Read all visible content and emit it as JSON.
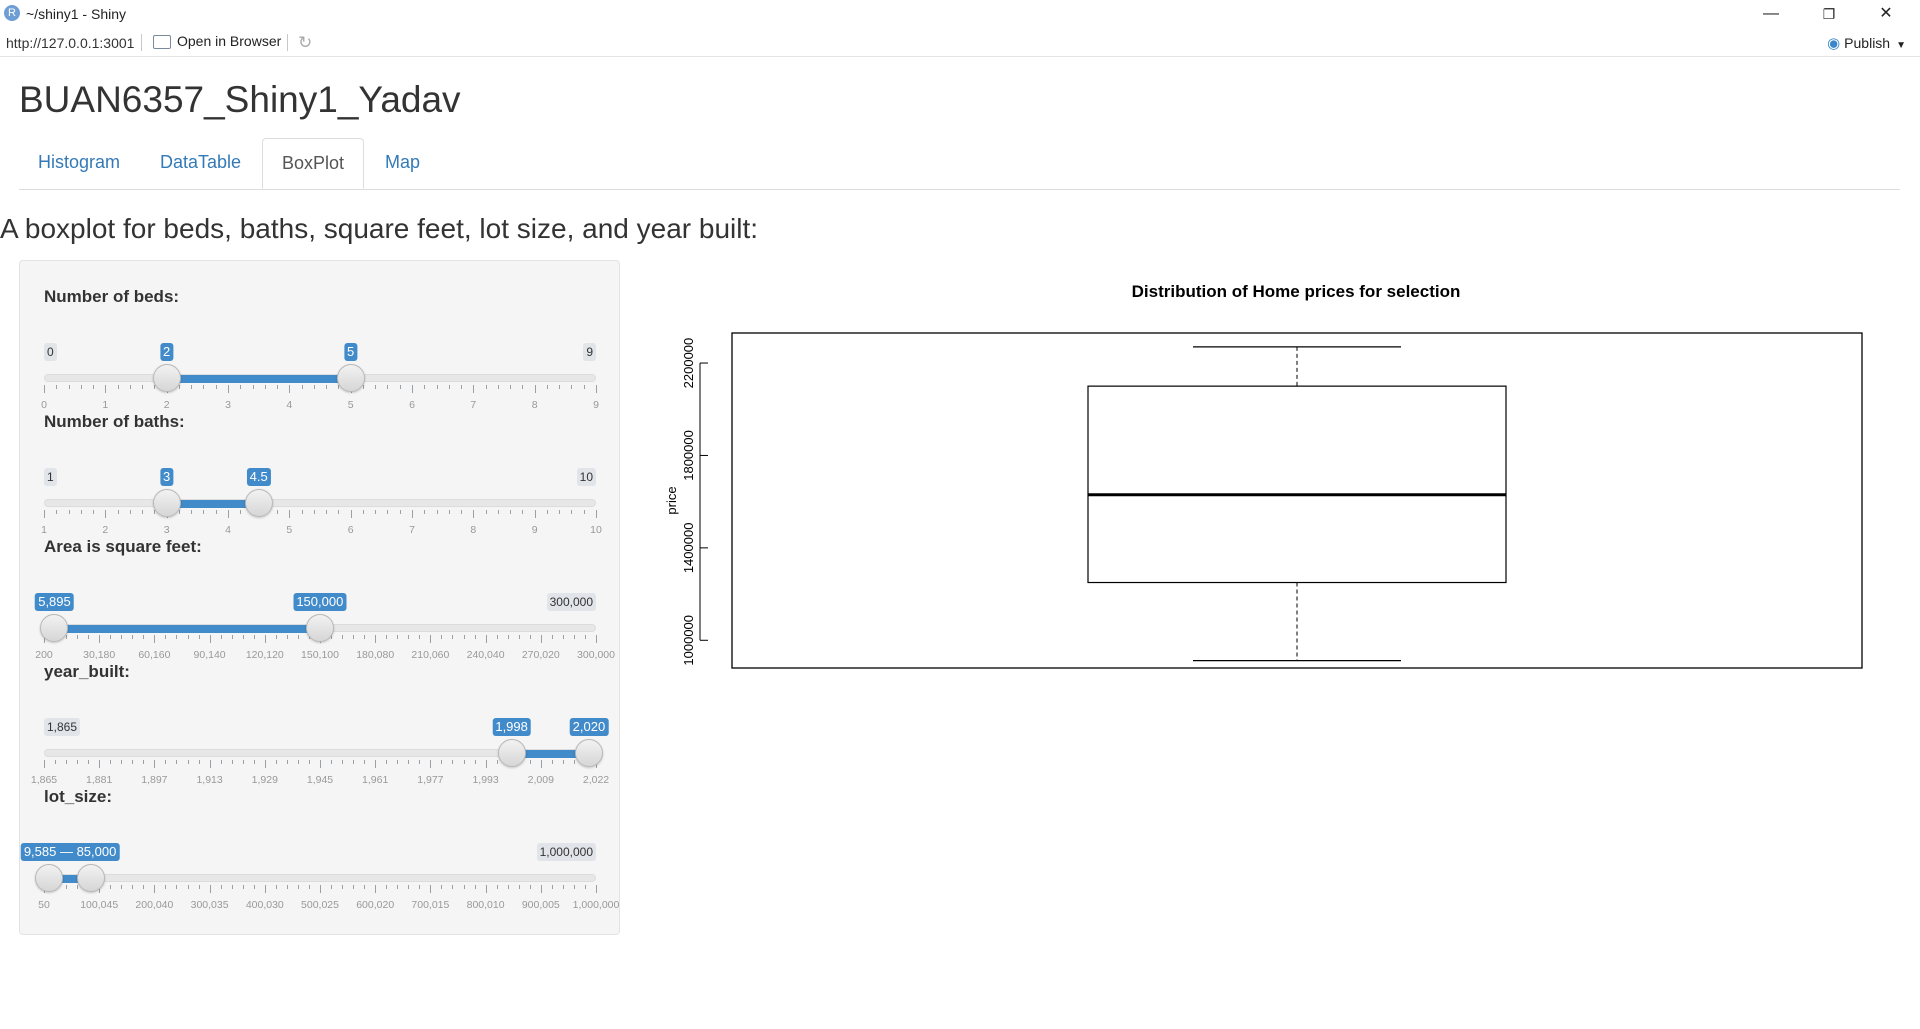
{
  "window": {
    "title": "~/shiny1 - Shiny",
    "minimize": "—",
    "restore": "❐",
    "close": "✕"
  },
  "toolbar": {
    "url": "http://127.0.0.1:3001",
    "open_in_browser": "Open in Browser",
    "refresh_icon": "↻",
    "publish": "Publish"
  },
  "app": {
    "title": "BUAN6357_Shiny1_Yadav",
    "tabs": [
      "Histogram",
      "DataTable",
      "BoxPlot",
      "Map"
    ],
    "active_tab": "BoxPlot",
    "heading": "A boxplot for beds, baths, square feet, lot size, and year built:"
  },
  "sliders": [
    {
      "label": "Number of beds:",
      "min": "0",
      "max": "9",
      "from": "2",
      "to": "5",
      "from_value": 2,
      "to_value": 5,
      "range": [
        0,
        9
      ],
      "ticks": [
        "0",
        "1",
        "2",
        "3",
        "4",
        "5",
        "6",
        "7",
        "8",
        "9"
      ]
    },
    {
      "label": "Number of baths:",
      "min": "1",
      "max": "10",
      "from": "3",
      "to": "4.5",
      "from_value": 3,
      "to_value": 4.5,
      "range": [
        1,
        10
      ],
      "ticks": [
        "1",
        "2",
        "3",
        "4",
        "5",
        "6",
        "7",
        "8",
        "9",
        "10"
      ]
    },
    {
      "label": "Area is square feet:",
      "min": "200",
      "max": "300,000",
      "from": "5,895",
      "to": "150,000",
      "from_value": 5895,
      "to_value": 150000,
      "range": [
        200,
        300000
      ],
      "ticks": [
        "200",
        "30,180",
        "60,160",
        "90,140",
        "120,120",
        "150,100",
        "180,080",
        "210,060",
        "240,040",
        "270,020",
        "300,000"
      ]
    },
    {
      "label": "year_built:",
      "min": "1,865",
      "max": "2,022",
      "from": "1,998",
      "to": "2,020",
      "from_value": 1998,
      "to_value": 2020,
      "range": [
        1865,
        2022
      ],
      "ticks": [
        "1,865",
        "1,881",
        "1,897",
        "1,913",
        "1,929",
        "1,945",
        "1,961",
        "1,977",
        "1,993",
        "2,009",
        "2,022"
      ]
    },
    {
      "label": "lot_size:",
      "min": "50",
      "max": "1,000,000",
      "from": "9,585",
      "to": "85,000",
      "combined": "9,585 — 85,000",
      "from_value": 9585,
      "to_value": 85000,
      "range": [
        50,
        1000000
      ],
      "ticks": [
        "50",
        "100,045",
        "200,040",
        "300,035",
        "400,030",
        "500,025",
        "600,020",
        "700,015",
        "800,010",
        "900,005",
        "1,000,000"
      ]
    }
  ],
  "chart_data": {
    "type": "boxplot",
    "title": "Distribution of Home prices for selection",
    "xlabel": "",
    "ylabel": "price",
    "ylim": [
      880000,
      2330000
    ],
    "yticks": [
      1000000,
      1400000,
      1800000,
      2200000
    ],
    "ytick_labels": [
      "1000000",
      "1400000",
      "1800000",
      "2200000"
    ],
    "whisker_low": 912000,
    "q1": 1250000,
    "median": 1630000,
    "q3": 2100000,
    "whisker_high": 2270000
  }
}
